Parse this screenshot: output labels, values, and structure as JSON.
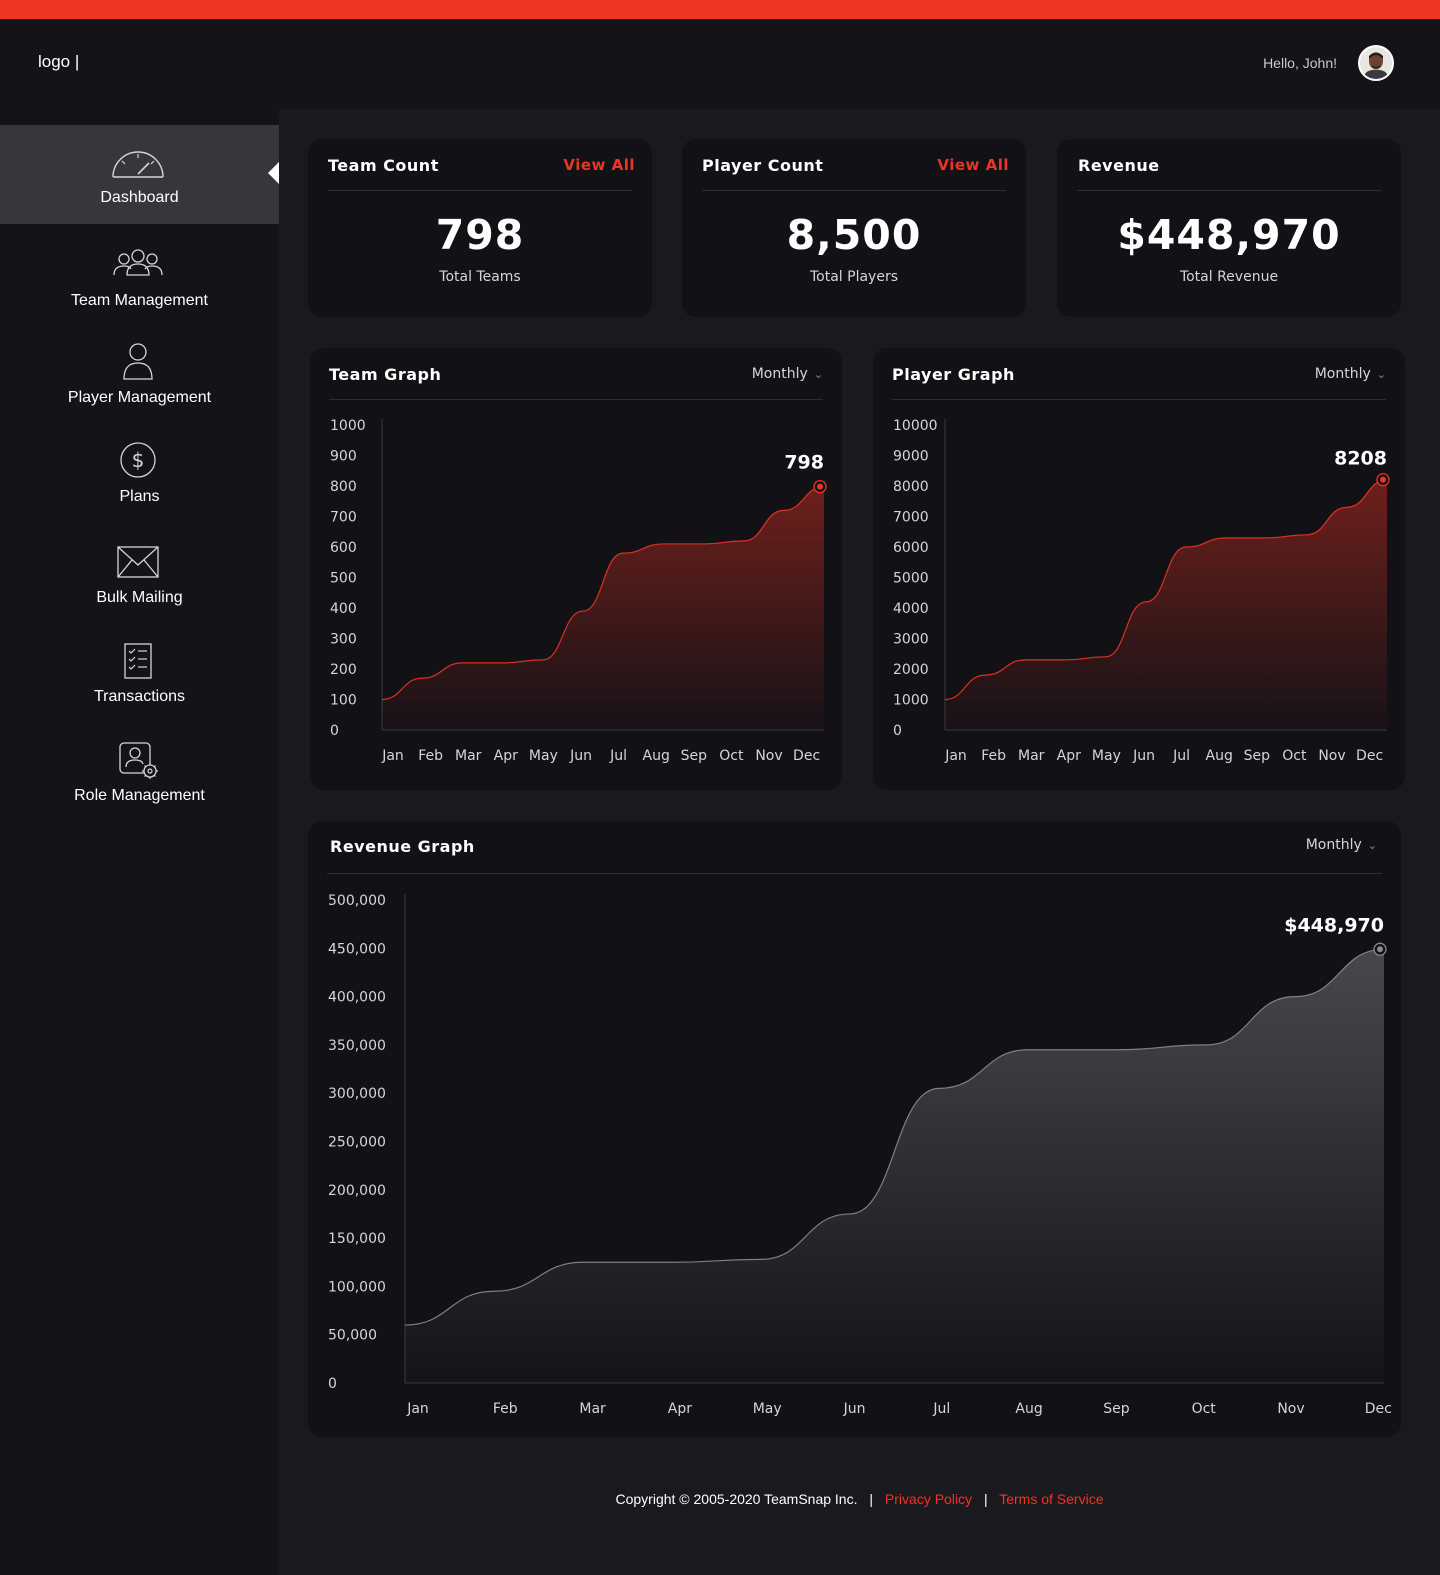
{
  "header": {
    "logo": "logo |",
    "greeting": "Hello, John!"
  },
  "sidebar": {
    "items": [
      {
        "label": "Dashboard",
        "icon": "speedometer-icon",
        "active": true
      },
      {
        "label": "Team Management",
        "icon": "team-icon"
      },
      {
        "label": "Player Management",
        "icon": "user-icon"
      },
      {
        "label": "Plans",
        "icon": "dollar-coin-icon"
      },
      {
        "label": "Bulk Mailing",
        "icon": "envelope-icon"
      },
      {
        "label": "Transactions",
        "icon": "checklist-icon"
      },
      {
        "label": "Role Management",
        "icon": "user-settings-icon"
      }
    ]
  },
  "stats": {
    "team": {
      "title": "Team Count",
      "link": "View All",
      "value": "798",
      "caption": "Total Teams"
    },
    "player": {
      "title": "Player Count",
      "link": "View All",
      "value": "8,500",
      "caption": "Total Players"
    },
    "revenue": {
      "title": "Revenue",
      "value": "$448,970",
      "caption": "Total Revenue"
    }
  },
  "graphs": {
    "team": {
      "title": "Team Graph",
      "period": "Monthly"
    },
    "player": {
      "title": "Player Graph",
      "period": "Monthly"
    },
    "revenue": {
      "title": "Revenue Graph",
      "period": "Monthly"
    }
  },
  "footer": {
    "copyright": "Copyright © 2005-2020 TeamSnap Inc.",
    "separator": "|",
    "privacy": "Privacy Policy",
    "terms": "Terms of Service"
  },
  "colors": {
    "accent": "#ee3424",
    "background": "#1a191e",
    "card": "#121116",
    "sidebar_active": "#37363a"
  },
  "chart_data": [
    {
      "type": "area",
      "title": "Team Graph",
      "categories": [
        "Jan",
        "Feb",
        "Mar",
        "Apr",
        "May",
        "Jun",
        "Jul",
        "Aug",
        "Sep",
        "Oct",
        "Nov",
        "Dec"
      ],
      "values": [
        100,
        170,
        220,
        220,
        230,
        390,
        580,
        610,
        610,
        620,
        720,
        798
      ],
      "ylim": [
        0,
        1000
      ],
      "yticks": [
        1000,
        900,
        800,
        700,
        600,
        500,
        400,
        300,
        200,
        100,
        0
      ],
      "ytick_labels": [
        "1000",
        "900",
        "800",
        "700",
        "600",
        "500",
        "400",
        "300",
        "200",
        "100",
        "0"
      ],
      "end_label": "798",
      "color": "#ee3424"
    },
    {
      "type": "area",
      "title": "Player Graph",
      "categories": [
        "Jan",
        "Feb",
        "Mar",
        "Apr",
        "May",
        "Jun",
        "Jul",
        "Aug",
        "Sep",
        "Oct",
        "Nov",
        "Dec"
      ],
      "values": [
        1000,
        1800,
        2300,
        2300,
        2400,
        4200,
        6000,
        6300,
        6300,
        6400,
        7300,
        8208
      ],
      "ylim": [
        0,
        10000
      ],
      "yticks": [
        10000,
        9000,
        8000,
        7000,
        6000,
        5000,
        4000,
        3000,
        2000,
        1000,
        0
      ],
      "ytick_labels": [
        "10000",
        "9000",
        "8000",
        "7000",
        "6000",
        "5000",
        "4000",
        "3000",
        "2000",
        "1000",
        "0"
      ],
      "end_label": "8208",
      "color": "#ee3424"
    },
    {
      "type": "area",
      "title": "Revenue Graph",
      "categories": [
        "Jan",
        "Feb",
        "Mar",
        "Apr",
        "May",
        "Jun",
        "Jul",
        "Aug",
        "Sep",
        "Oct",
        "Nov",
        "Dec"
      ],
      "values": [
        60000,
        95000,
        125000,
        125000,
        128000,
        175000,
        305000,
        345000,
        345000,
        350000,
        400000,
        448970
      ],
      "ylim": [
        0,
        500000
      ],
      "yticks": [
        500000,
        450000,
        400000,
        350000,
        300000,
        250000,
        200000,
        150000,
        100000,
        50000,
        0
      ],
      "ytick_labels": [
        "500,000",
        "450,000",
        "400,000",
        "350,000",
        "300,000",
        "250,000",
        "200,000",
        "150,000",
        "100,000",
        "50,000",
        "0"
      ],
      "end_label": "$448,970",
      "color": "#8a8a8e"
    }
  ]
}
